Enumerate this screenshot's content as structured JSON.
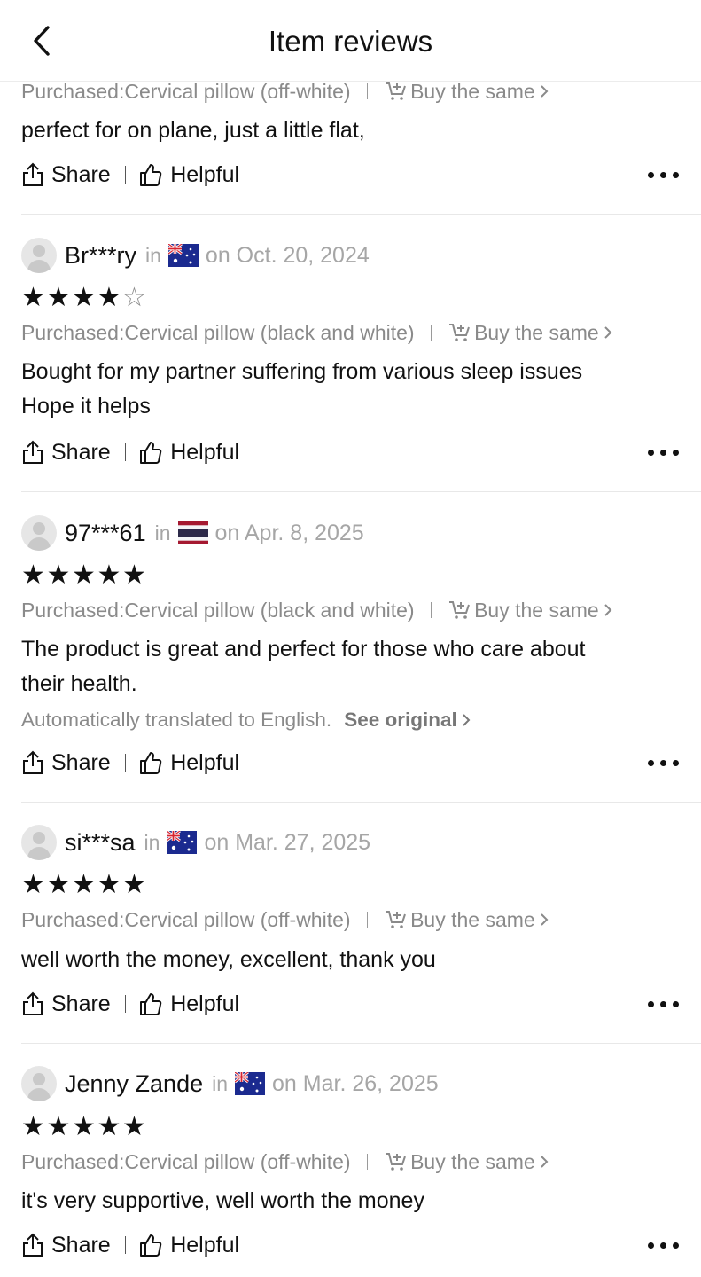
{
  "header": {
    "title": "Item reviews",
    "back_icon": "chevron-left-icon"
  },
  "labels": {
    "share": "Share",
    "helpful": "Helpful",
    "buy_same": "Buy the same",
    "in": "in"
  },
  "reviews": [
    {
      "purchased": "Purchased:Cervical pillow (off-white)",
      "text_lines": [
        "perfect for on plane, just a little flat,"
      ]
    },
    {
      "user": "Br***ry",
      "country_flag": "australia-flag",
      "date": "on Oct. 20, 2024",
      "rating": 4,
      "purchased": "Purchased:Cervical pillow (black and white)",
      "text_lines": [
        "Bought for my partner suffering from various sleep issues",
        "Hope it helps"
      ]
    },
    {
      "user": "97***61",
      "country_flag": "thailand-flag",
      "date": "on Apr. 8, 2025",
      "rating": 5,
      "purchased": "Purchased:Cervical pillow (black and white)",
      "text_lines": [
        "The product is great and perfect for those who care about",
        "their health."
      ],
      "translation_note": "Automatically translated to English.",
      "see_original": "See original"
    },
    {
      "user": "si***sa",
      "country_flag": "australia-flag",
      "date": "on Mar. 27, 2025",
      "rating": 5,
      "purchased": "Purchased:Cervical pillow (off-white)",
      "text_lines": [
        "well worth the money, excellent, thank you"
      ]
    },
    {
      "user": "Jenny Zande",
      "country_flag": "australia-flag",
      "date": "on Mar. 26, 2025",
      "rating": 5,
      "purchased": "Purchased:Cervical pillow (off-white)",
      "text_lines": [
        "it's very supportive, well worth the money"
      ]
    }
  ]
}
